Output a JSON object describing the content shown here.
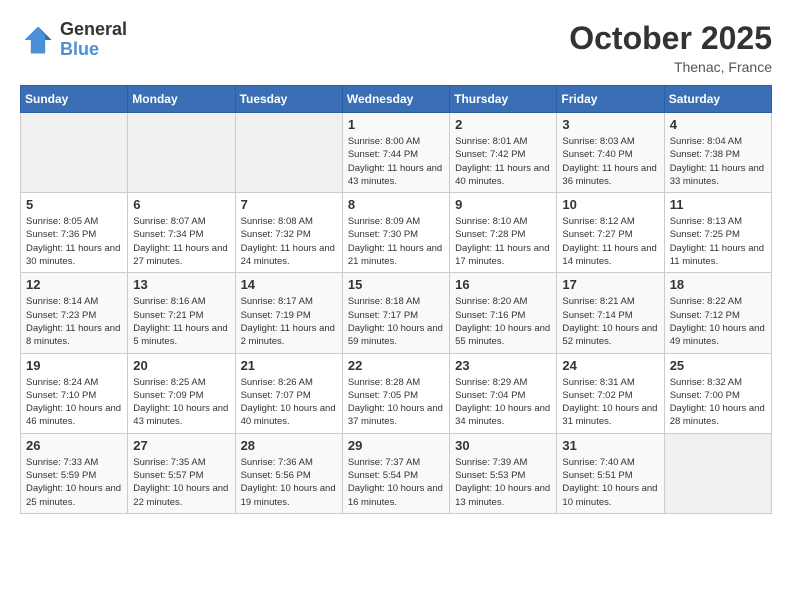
{
  "header": {
    "logo_general": "General",
    "logo_blue": "Blue",
    "month_year": "October 2025",
    "location": "Thenac, France"
  },
  "days_of_week": [
    "Sunday",
    "Monday",
    "Tuesday",
    "Wednesday",
    "Thursday",
    "Friday",
    "Saturday"
  ],
  "weeks": [
    [
      {
        "day": "",
        "sunrise": "",
        "sunset": "",
        "daylight": ""
      },
      {
        "day": "",
        "sunrise": "",
        "sunset": "",
        "daylight": ""
      },
      {
        "day": "",
        "sunrise": "",
        "sunset": "",
        "daylight": ""
      },
      {
        "day": "1",
        "sunrise": "Sunrise: 8:00 AM",
        "sunset": "Sunset: 7:44 PM",
        "daylight": "Daylight: 11 hours and 43 minutes."
      },
      {
        "day": "2",
        "sunrise": "Sunrise: 8:01 AM",
        "sunset": "Sunset: 7:42 PM",
        "daylight": "Daylight: 11 hours and 40 minutes."
      },
      {
        "day": "3",
        "sunrise": "Sunrise: 8:03 AM",
        "sunset": "Sunset: 7:40 PM",
        "daylight": "Daylight: 11 hours and 36 minutes."
      },
      {
        "day": "4",
        "sunrise": "Sunrise: 8:04 AM",
        "sunset": "Sunset: 7:38 PM",
        "daylight": "Daylight: 11 hours and 33 minutes."
      }
    ],
    [
      {
        "day": "5",
        "sunrise": "Sunrise: 8:05 AM",
        "sunset": "Sunset: 7:36 PM",
        "daylight": "Daylight: 11 hours and 30 minutes."
      },
      {
        "day": "6",
        "sunrise": "Sunrise: 8:07 AM",
        "sunset": "Sunset: 7:34 PM",
        "daylight": "Daylight: 11 hours and 27 minutes."
      },
      {
        "day": "7",
        "sunrise": "Sunrise: 8:08 AM",
        "sunset": "Sunset: 7:32 PM",
        "daylight": "Daylight: 11 hours and 24 minutes."
      },
      {
        "day": "8",
        "sunrise": "Sunrise: 8:09 AM",
        "sunset": "Sunset: 7:30 PM",
        "daylight": "Daylight: 11 hours and 21 minutes."
      },
      {
        "day": "9",
        "sunrise": "Sunrise: 8:10 AM",
        "sunset": "Sunset: 7:28 PM",
        "daylight": "Daylight: 11 hours and 17 minutes."
      },
      {
        "day": "10",
        "sunrise": "Sunrise: 8:12 AM",
        "sunset": "Sunset: 7:27 PM",
        "daylight": "Daylight: 11 hours and 14 minutes."
      },
      {
        "day": "11",
        "sunrise": "Sunrise: 8:13 AM",
        "sunset": "Sunset: 7:25 PM",
        "daylight": "Daylight: 11 hours and 11 minutes."
      }
    ],
    [
      {
        "day": "12",
        "sunrise": "Sunrise: 8:14 AM",
        "sunset": "Sunset: 7:23 PM",
        "daylight": "Daylight: 11 hours and 8 minutes."
      },
      {
        "day": "13",
        "sunrise": "Sunrise: 8:16 AM",
        "sunset": "Sunset: 7:21 PM",
        "daylight": "Daylight: 11 hours and 5 minutes."
      },
      {
        "day": "14",
        "sunrise": "Sunrise: 8:17 AM",
        "sunset": "Sunset: 7:19 PM",
        "daylight": "Daylight: 11 hours and 2 minutes."
      },
      {
        "day": "15",
        "sunrise": "Sunrise: 8:18 AM",
        "sunset": "Sunset: 7:17 PM",
        "daylight": "Daylight: 10 hours and 59 minutes."
      },
      {
        "day": "16",
        "sunrise": "Sunrise: 8:20 AM",
        "sunset": "Sunset: 7:16 PM",
        "daylight": "Daylight: 10 hours and 55 minutes."
      },
      {
        "day": "17",
        "sunrise": "Sunrise: 8:21 AM",
        "sunset": "Sunset: 7:14 PM",
        "daylight": "Daylight: 10 hours and 52 minutes."
      },
      {
        "day": "18",
        "sunrise": "Sunrise: 8:22 AM",
        "sunset": "Sunset: 7:12 PM",
        "daylight": "Daylight: 10 hours and 49 minutes."
      }
    ],
    [
      {
        "day": "19",
        "sunrise": "Sunrise: 8:24 AM",
        "sunset": "Sunset: 7:10 PM",
        "daylight": "Daylight: 10 hours and 46 minutes."
      },
      {
        "day": "20",
        "sunrise": "Sunrise: 8:25 AM",
        "sunset": "Sunset: 7:09 PM",
        "daylight": "Daylight: 10 hours and 43 minutes."
      },
      {
        "day": "21",
        "sunrise": "Sunrise: 8:26 AM",
        "sunset": "Sunset: 7:07 PM",
        "daylight": "Daylight: 10 hours and 40 minutes."
      },
      {
        "day": "22",
        "sunrise": "Sunrise: 8:28 AM",
        "sunset": "Sunset: 7:05 PM",
        "daylight": "Daylight: 10 hours and 37 minutes."
      },
      {
        "day": "23",
        "sunrise": "Sunrise: 8:29 AM",
        "sunset": "Sunset: 7:04 PM",
        "daylight": "Daylight: 10 hours and 34 minutes."
      },
      {
        "day": "24",
        "sunrise": "Sunrise: 8:31 AM",
        "sunset": "Sunset: 7:02 PM",
        "daylight": "Daylight: 10 hours and 31 minutes."
      },
      {
        "day": "25",
        "sunrise": "Sunrise: 8:32 AM",
        "sunset": "Sunset: 7:00 PM",
        "daylight": "Daylight: 10 hours and 28 minutes."
      }
    ],
    [
      {
        "day": "26",
        "sunrise": "Sunrise: 7:33 AM",
        "sunset": "Sunset: 5:59 PM",
        "daylight": "Daylight: 10 hours and 25 minutes."
      },
      {
        "day": "27",
        "sunrise": "Sunrise: 7:35 AM",
        "sunset": "Sunset: 5:57 PM",
        "daylight": "Daylight: 10 hours and 22 minutes."
      },
      {
        "day": "28",
        "sunrise": "Sunrise: 7:36 AM",
        "sunset": "Sunset: 5:56 PM",
        "daylight": "Daylight: 10 hours and 19 minutes."
      },
      {
        "day": "29",
        "sunrise": "Sunrise: 7:37 AM",
        "sunset": "Sunset: 5:54 PM",
        "daylight": "Daylight: 10 hours and 16 minutes."
      },
      {
        "day": "30",
        "sunrise": "Sunrise: 7:39 AM",
        "sunset": "Sunset: 5:53 PM",
        "daylight": "Daylight: 10 hours and 13 minutes."
      },
      {
        "day": "31",
        "sunrise": "Sunrise: 7:40 AM",
        "sunset": "Sunset: 5:51 PM",
        "daylight": "Daylight: 10 hours and 10 minutes."
      },
      {
        "day": "",
        "sunrise": "",
        "sunset": "",
        "daylight": ""
      }
    ]
  ]
}
